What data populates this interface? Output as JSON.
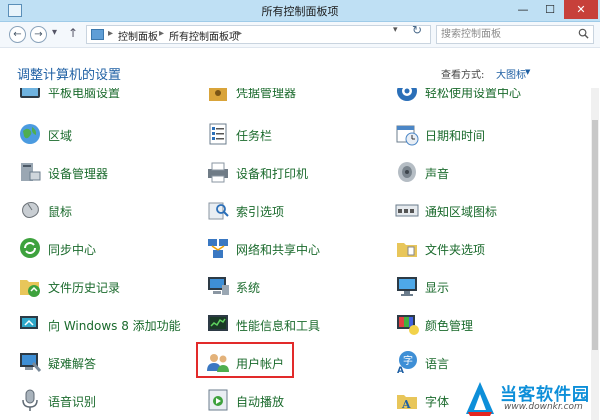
{
  "window": {
    "title": "所有控制面板项",
    "minimize_glyph": "—",
    "maximize_glyph": "☐",
    "close_glyph": "✕"
  },
  "nav": {
    "back_glyph": "←",
    "forward_glyph": "→",
    "recent_glyph": "▾",
    "up_glyph": "↑",
    "breadcrumbs": [
      "控制面板",
      "所有控制面板项"
    ],
    "breadcrumb_sep": "▸",
    "dropdown_glyph": "▾",
    "refresh_glyph": "↻"
  },
  "search": {
    "placeholder": "搜索控制面板"
  },
  "header": {
    "title": "调整计算机的设置",
    "view_label": "查看方式:",
    "view_value": "大图标",
    "view_caret": "▼"
  },
  "items": [
    {
      "label": "平板电脑设置",
      "icon": "tablet-icon"
    },
    {
      "label": "凭据管理器",
      "icon": "credential-icon"
    },
    {
      "label": "轻松使用设置中心",
      "icon": "ease-of-access-icon"
    },
    {
      "label": "区域",
      "icon": "region-icon"
    },
    {
      "label": "任务栏",
      "icon": "taskbar-icon"
    },
    {
      "label": "日期和时间",
      "icon": "calendar-icon"
    },
    {
      "label": "设备管理器",
      "icon": "device-manager-icon"
    },
    {
      "label": "设备和打印机",
      "icon": "printer-icon"
    },
    {
      "label": "声音",
      "icon": "speaker-icon"
    },
    {
      "label": "鼠标",
      "icon": "mouse-icon"
    },
    {
      "label": "索引选项",
      "icon": "index-icon"
    },
    {
      "label": "通知区域图标",
      "icon": "notification-icon"
    },
    {
      "label": "同步中心",
      "icon": "sync-icon"
    },
    {
      "label": "网络和共享中心",
      "icon": "network-icon"
    },
    {
      "label": "文件夹选项",
      "icon": "folder-options-icon"
    },
    {
      "label": "文件历史记录",
      "icon": "file-history-icon"
    },
    {
      "label": "系统",
      "icon": "system-icon"
    },
    {
      "label": "显示",
      "icon": "display-icon"
    },
    {
      "label": "向 Windows 8 添加功能",
      "icon": "add-features-icon"
    },
    {
      "label": "性能信息和工具",
      "icon": "performance-icon"
    },
    {
      "label": "颜色管理",
      "icon": "color-management-icon"
    },
    {
      "label": "疑难解答",
      "icon": "troubleshooting-icon"
    },
    {
      "label": "用户帐户",
      "icon": "user-accounts-icon"
    },
    {
      "label": "语言",
      "icon": "language-icon"
    },
    {
      "label": "语音识别",
      "icon": "microphone-icon"
    },
    {
      "label": "自动播放",
      "icon": "autoplay-icon"
    },
    {
      "label": "字体",
      "icon": "fonts-icon"
    }
  ],
  "watermark": {
    "title": "当客软件园",
    "url": "www.downkr.com"
  },
  "colors": {
    "link_green": "#1a6a2c",
    "title_blue": "#1e5fa3",
    "highlight_red": "#e22a2a",
    "close_red": "#c7403a"
  }
}
